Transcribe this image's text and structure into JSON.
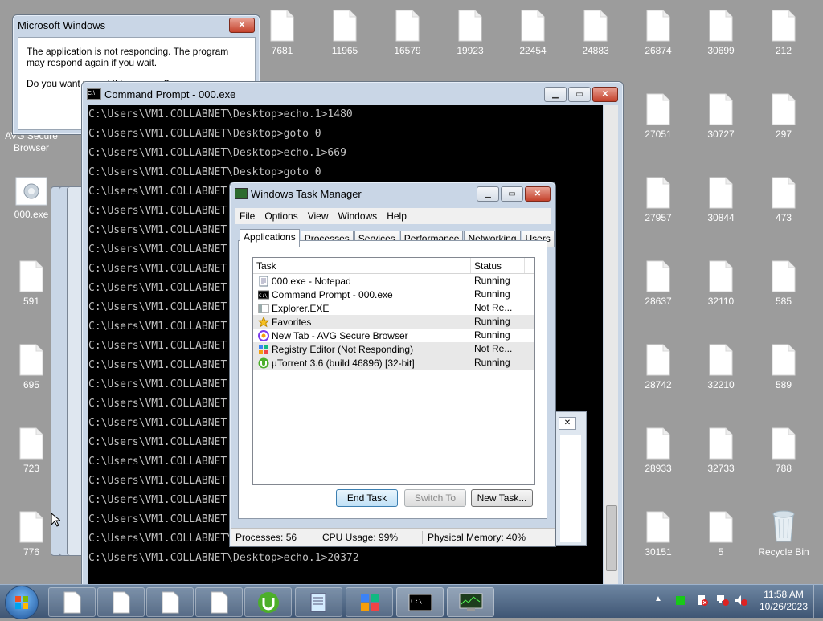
{
  "desktop": {
    "icons": [
      {
        "label": "7681"
      },
      {
        "label": "11965"
      },
      {
        "label": "16579"
      },
      {
        "label": "19923"
      },
      {
        "label": "22454"
      },
      {
        "label": "24883"
      },
      {
        "label": "26874"
      },
      {
        "label": "30699"
      },
      {
        "label": "212"
      },
      {
        "label": "27051"
      },
      {
        "label": "30727"
      },
      {
        "label": "297"
      },
      {
        "label": "27957"
      },
      {
        "label": "30844"
      },
      {
        "label": "473"
      },
      {
        "label": "28637"
      },
      {
        "label": "32110"
      },
      {
        "label": "585"
      },
      {
        "label": "28742"
      },
      {
        "label": "32210"
      },
      {
        "label": "589"
      },
      {
        "label": "28933"
      },
      {
        "label": "32733"
      },
      {
        "label": "788"
      },
      {
        "label": "30151"
      },
      {
        "label": "5"
      },
      {
        "label": "Recycle Bin"
      },
      {
        "label": "591"
      },
      {
        "label": "695"
      },
      {
        "label": "723"
      },
      {
        "label": "776"
      },
      {
        "label": "AVG Secure Browser"
      },
      {
        "label": "000.exe"
      }
    ]
  },
  "dialog": {
    "title": "Microsoft Windows",
    "message": "The application is not responding. The program may respond again if you wait.",
    "question": "Do you want to end this process?"
  },
  "cmd": {
    "title": "Command Prompt - 000.exe",
    "lines": [
      "C:\\Users\\VM1.COLLABNET\\Desktop>echo.1>1480",
      "C:\\Users\\VM1.COLLABNET\\Desktop>goto 0",
      "C:\\Users\\VM1.COLLABNET\\Desktop>echo.1>669",
      "C:\\Users\\VM1.COLLABNET\\Desktop>goto 0",
      "C:\\Users\\VM1.COLLABNET",
      "C:\\Users\\VM1.COLLABNET",
      "C:\\Users\\VM1.COLLABNET",
      "C:\\Users\\VM1.COLLABNET",
      "C:\\Users\\VM1.COLLABNET",
      "C:\\Users\\VM1.COLLABNET",
      "C:\\Users\\VM1.COLLABNET",
      "C:\\Users\\VM1.COLLABNET",
      "C:\\Users\\VM1.COLLABNET",
      "C:\\Users\\VM1.COLLABNET",
      "C:\\Users\\VM1.COLLABNET",
      "C:\\Users\\VM1.COLLABNET",
      "C:\\Users\\VM1.COLLABNET",
      "C:\\Users\\VM1.COLLABNET",
      "C:\\Users\\VM1.COLLABNET",
      "C:\\Users\\VM1.COLLABNET",
      "C:\\Users\\VM1.COLLABNET",
      "C:\\Users\\VM1.COLLABNET",
      "C:\\Users\\VM1.COLLABNET\\Desktop>goto 0",
      "C:\\Users\\VM1.COLLABNET\\Desktop>echo.1>20372"
    ]
  },
  "taskmgr": {
    "title": "Windows Task Manager",
    "menu": [
      "File",
      "Options",
      "View",
      "Windows",
      "Help"
    ],
    "tabs": [
      "Applications",
      "Processes",
      "Services",
      "Performance",
      "Networking",
      "Users"
    ],
    "columns": {
      "task": "Task",
      "status": "Status"
    },
    "rows": [
      {
        "task": "000.exe - Notepad",
        "status": "Running",
        "icon": "notepad-icon"
      },
      {
        "task": "Command Prompt - 000.exe",
        "status": "Running",
        "icon": "cmd-icon"
      },
      {
        "task": "Explorer.EXE",
        "status": "Not Re...",
        "icon": "explorer-icon"
      },
      {
        "task": "Favorites",
        "status": "Running",
        "icon": "star-icon"
      },
      {
        "task": "New Tab - AVG Secure Browser",
        "status": "Running",
        "icon": "browser-icon"
      },
      {
        "task": "Registry Editor (Not Responding)",
        "status": "Not Re...",
        "icon": "regedit-icon"
      },
      {
        "task": "µTorrent 3.6  (build 46896) [32-bit]",
        "status": "Running",
        "icon": "utorrent-icon"
      }
    ],
    "buttons": {
      "end": "End Task",
      "switch": "Switch To",
      "new": "New Task..."
    },
    "status": {
      "processes": "Processes: 56",
      "cpu": "CPU Usage: 99%",
      "memory": "Physical Memory: 40%"
    }
  },
  "taskbar": {
    "time": "11:58 AM",
    "date": "10/26/2023"
  }
}
